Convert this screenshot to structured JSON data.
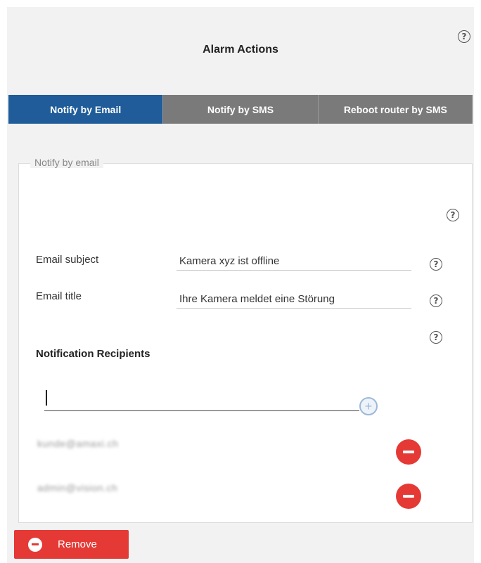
{
  "header": {
    "title": "Alarm Actions",
    "help_glyph": "?"
  },
  "tabs": [
    {
      "label": "Notify by Email",
      "active": true
    },
    {
      "label": "Notify by SMS",
      "active": false
    },
    {
      "label": "Reboot router by SMS",
      "active": false
    }
  ],
  "email_section": {
    "legend": "Notify by email",
    "subject_label": "Email subject",
    "subject_value": "Kamera xyz ist offline",
    "title_label": "Email title",
    "title_value": "Ihre Kamera meldet eine Störung",
    "recipients_title": "Notification Recipients",
    "new_recipient_value": "",
    "add_glyph": "+",
    "recipients": [
      {
        "email": "kunde@amaxi.ch"
      },
      {
        "email": "admin@vision.ch"
      }
    ]
  },
  "footer": {
    "remove_label": "Remove"
  },
  "colors": {
    "tab_active": "#1f5c99",
    "tab_inactive": "#7a7a7a",
    "danger": "#e53935"
  }
}
